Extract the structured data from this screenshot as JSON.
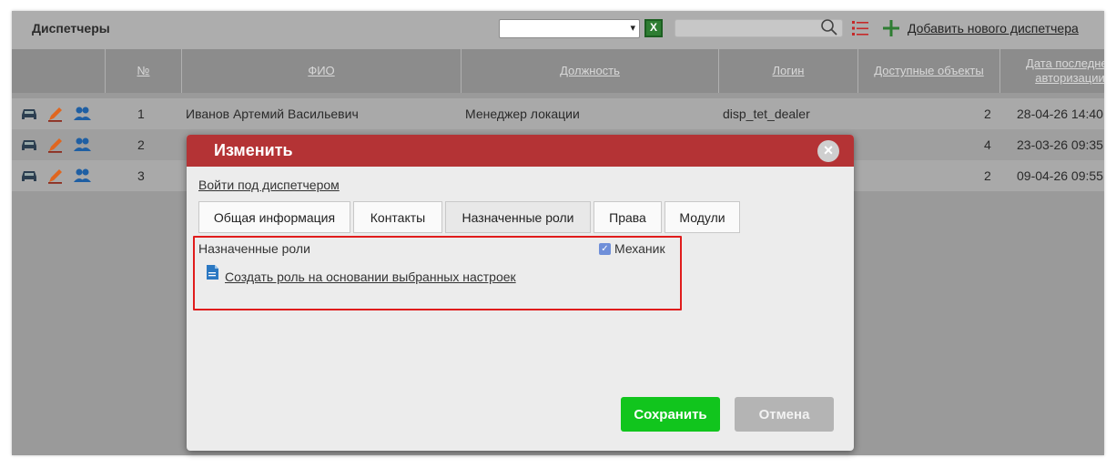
{
  "toolbar": {
    "title": "Диспетчеры",
    "select_value": "",
    "select_arrow": "▾",
    "excel_icon_label": "X",
    "search_value": "",
    "add_link": "Добавить нового диспетчера",
    "icons": [
      "excel-icon",
      "search-icon",
      "list-icon",
      "plus-icon"
    ]
  },
  "table": {
    "headers": [
      "",
      "№",
      "ФИО",
      "Должность",
      "Логин",
      "Доступные объекты",
      "Дата последней авторизации"
    ],
    "rows": [
      {
        "num": "1",
        "fio": "Иванов Артемий Васильевич",
        "position": "Менеджер локации",
        "login": "disp_tet_dealer",
        "objects": "2",
        "date": "28-04-26 14:40"
      },
      {
        "num": "2",
        "fio": "",
        "position": "",
        "login": "",
        "objects": "4",
        "date": "23-03-26 09:35"
      },
      {
        "num": "3",
        "fio": "",
        "position": "",
        "login": "",
        "objects": "2",
        "date": "09-04-26 09:55"
      }
    ],
    "row_icons": [
      "car-icon",
      "pencil-icon",
      "users-icon"
    ]
  },
  "modal": {
    "title": "Изменить",
    "close_glyph": "×",
    "login_as": "Войти под диспетчером",
    "tabs": [
      "Общая информация",
      "Контакты",
      "Назначенные роли",
      "Права",
      "Модули"
    ],
    "active_tab": "Назначенные роли",
    "roles_label": "Назначенные роли",
    "role_checkbox": {
      "label": "Механик",
      "checked": true,
      "mark": "✓"
    },
    "create_role_link": "Создать роль на основании выбранных настроек",
    "save_button": "Сохранить",
    "cancel_button": "Отмена"
  },
  "colors": {
    "modal_header": "#b43335",
    "save_button": "#11c51d",
    "cancel_button": "#b4b4b4",
    "highlight_border": "#e01c1c",
    "checkbox": "#6f8fd9"
  }
}
